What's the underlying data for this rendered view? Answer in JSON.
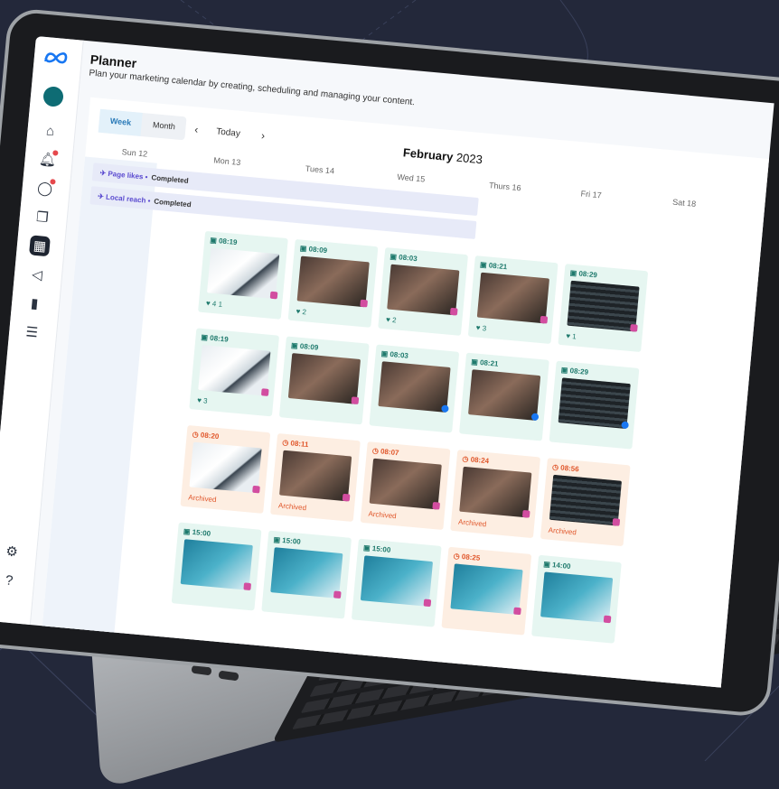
{
  "app": {
    "title": "Planner",
    "subtitle": "Plan your marketing calendar by creating, scheduling and managing your content."
  },
  "toolbar": {
    "week": "Week",
    "month": "Month",
    "prev": "‹",
    "today": "Today",
    "next": "›",
    "period_month": "February",
    "period_year": "2023"
  },
  "days": [
    "Sun 12",
    "Mon 13",
    "Tues 14",
    "Wed 15",
    "Thurs 16",
    "Fri 17",
    "Sat 18"
  ],
  "campaigns": [
    {
      "label": "Page likes",
      "status": "Completed"
    },
    {
      "label": "Local reach",
      "status": "Completed"
    }
  ],
  "rows": [
    {
      "cards": [
        {
          "time": "08:19",
          "stat": "4  1",
          "kind": "post"
        },
        {
          "time": "08:09",
          "stat": "2",
          "kind": "post"
        },
        {
          "time": "08:03",
          "stat": "2",
          "kind": "post"
        },
        {
          "time": "08:21",
          "stat": "3",
          "kind": "post"
        },
        {
          "time": "08:29",
          "stat": "1",
          "kind": "post"
        }
      ]
    },
    {
      "cards": [
        {
          "time": "08:19",
          "stat": "3",
          "kind": "post"
        },
        {
          "time": "08:09",
          "stat": "",
          "kind": "post"
        },
        {
          "time": "08:03",
          "stat": "",
          "kind": "post"
        },
        {
          "time": "08:21",
          "stat": "",
          "kind": "post"
        },
        {
          "time": "08:29",
          "stat": "",
          "kind": "post"
        }
      ]
    },
    {
      "cards": [
        {
          "time": "08:20",
          "stat": "Archived",
          "kind": "archived"
        },
        {
          "time": "08:11",
          "stat": "Archived",
          "kind": "archived"
        },
        {
          "time": "08:07",
          "stat": "Archived",
          "kind": "archived"
        },
        {
          "time": "08:24",
          "stat": "Archived",
          "kind": "archived"
        },
        {
          "time": "08:56",
          "stat": "Archived",
          "kind": "archived"
        }
      ]
    },
    {
      "cards": [
        {
          "time": "15:00",
          "stat": "",
          "kind": "post"
        },
        {
          "time": "15:00",
          "stat": "",
          "kind": "post"
        },
        {
          "time": "15:00",
          "stat": "",
          "kind": "post"
        },
        {
          "time": "08:25",
          "stat": "",
          "kind": "archived"
        },
        {
          "time": "14:00",
          "stat": "",
          "kind": "post"
        }
      ]
    }
  ],
  "colors": {
    "accent": "#2a7ab8",
    "post_bg": "#e6f6f1",
    "archived_bg": "#fdeee2",
    "archived_text": "#e0562a",
    "background": "#23283a"
  },
  "icons": [
    "meta-logo-icon",
    "home-icon",
    "bell-icon",
    "chat-icon",
    "stack-icon",
    "calendar-grid-icon",
    "megaphone-icon",
    "bar-chart-icon",
    "menu-icon",
    "gear-icon",
    "help-icon"
  ]
}
